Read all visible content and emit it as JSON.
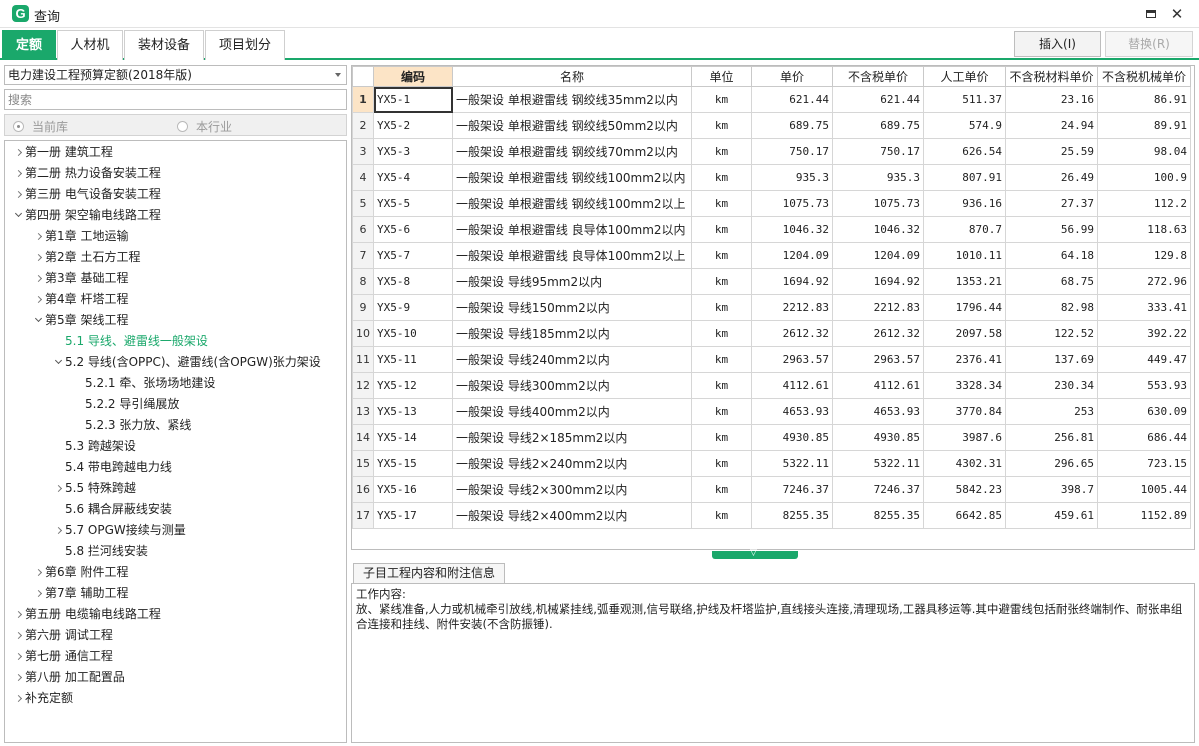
{
  "window": {
    "logo_letter": "G",
    "title": "查询",
    "maximize_icon": "maximize-icon",
    "close_icon": "close-icon",
    "close_glyph": "✕"
  },
  "tabs": [
    {
      "label": "定额",
      "active": true
    },
    {
      "label": "人材机",
      "active": false
    },
    {
      "label": "装材设备",
      "active": false
    },
    {
      "label": "项目划分",
      "active": false
    }
  ],
  "toolbar": {
    "insert_label": "插入(I)",
    "replace_label": "替换(R)"
  },
  "library": {
    "selected": "电力建设工程预算定额(2018年版)"
  },
  "search": {
    "placeholder": "搜索"
  },
  "scope": {
    "option1": "当前库",
    "option2": "本行业"
  },
  "tree": [
    {
      "label": "第一册 建筑工程",
      "level": 0,
      "expand": "collapsed"
    },
    {
      "label": "第二册 热力设备安装工程",
      "level": 0,
      "expand": "collapsed"
    },
    {
      "label": "第三册 电气设备安装工程",
      "level": 0,
      "expand": "collapsed"
    },
    {
      "label": "第四册 架空输电线路工程",
      "level": 0,
      "expand": "expanded"
    },
    {
      "label": "第1章 工地运输",
      "level": 1,
      "expand": "collapsed"
    },
    {
      "label": "第2章 土石方工程",
      "level": 1,
      "expand": "collapsed"
    },
    {
      "label": "第3章 基础工程",
      "level": 1,
      "expand": "collapsed"
    },
    {
      "label": "第4章 杆塔工程",
      "level": 1,
      "expand": "collapsed"
    },
    {
      "label": "第5章 架线工程",
      "level": 1,
      "expand": "expanded"
    },
    {
      "label": "5.1 导线、避雷线一般架设",
      "level": 2,
      "expand": "none",
      "selected": true
    },
    {
      "label": "5.2 导线(含OPPC)、避雷线(含OPGW)张力架设",
      "level": 2,
      "expand": "expanded"
    },
    {
      "label": "5.2.1 牵、张场场地建设",
      "level": 3,
      "expand": "none"
    },
    {
      "label": "5.2.2 导引绳展放",
      "level": 3,
      "expand": "none"
    },
    {
      "label": "5.2.3 张力放、紧线",
      "level": 3,
      "expand": "none"
    },
    {
      "label": "5.3 跨越架设",
      "level": 2,
      "expand": "none"
    },
    {
      "label": "5.4 带电跨越电力线",
      "level": 2,
      "expand": "none"
    },
    {
      "label": "5.5 特殊跨越",
      "level": 2,
      "expand": "collapsed"
    },
    {
      "label": "5.6 耦合屏蔽线安装",
      "level": 2,
      "expand": "none"
    },
    {
      "label": "5.7 OPGW接续与测量",
      "level": 2,
      "expand": "collapsed"
    },
    {
      "label": "5.8 拦河线安装",
      "level": 2,
      "expand": "none"
    },
    {
      "label": "第6章 附件工程",
      "level": 1,
      "expand": "collapsed"
    },
    {
      "label": "第7章 辅助工程",
      "level": 1,
      "expand": "collapsed"
    },
    {
      "label": "第五册 电缆输电线路工程",
      "level": 0,
      "expand": "collapsed"
    },
    {
      "label": "第六册 调试工程",
      "level": 0,
      "expand": "collapsed"
    },
    {
      "label": "第七册 通信工程",
      "level": 0,
      "expand": "collapsed"
    },
    {
      "label": "第八册 加工配置品",
      "level": 0,
      "expand": "collapsed"
    },
    {
      "label": "补充定额",
      "level": 0,
      "expand": "collapsed"
    }
  ],
  "grid": {
    "headers": [
      "编码",
      "名称",
      "单位",
      "单价",
      "不含税单价",
      "人工单价",
      "不含税材料单价",
      "不含税机械单价"
    ],
    "rows": [
      [
        "1",
        "YX5-1",
        "一般架设 单根避雷线 钢绞线35mm2以内",
        "km",
        "621.44",
        "621.44",
        "511.37",
        "23.16",
        "86.91"
      ],
      [
        "2",
        "YX5-2",
        "一般架设 单根避雷线 钢绞线50mm2以内",
        "km",
        "689.75",
        "689.75",
        "574.9",
        "24.94",
        "89.91"
      ],
      [
        "3",
        "YX5-3",
        "一般架设 单根避雷线 钢绞线70mm2以内",
        "km",
        "750.17",
        "750.17",
        "626.54",
        "25.59",
        "98.04"
      ],
      [
        "4",
        "YX5-4",
        "一般架设 单根避雷线 钢绞线100mm2以内",
        "km",
        "935.3",
        "935.3",
        "807.91",
        "26.49",
        "100.9"
      ],
      [
        "5",
        "YX5-5",
        "一般架设 单根避雷线 钢绞线100mm2以上",
        "km",
        "1075.73",
        "1075.73",
        "936.16",
        "27.37",
        "112.2"
      ],
      [
        "6",
        "YX5-6",
        "一般架设 单根避雷线 良导体100mm2以内",
        "km",
        "1046.32",
        "1046.32",
        "870.7",
        "56.99",
        "118.63"
      ],
      [
        "7",
        "YX5-7",
        "一般架设 单根避雷线 良导体100mm2以上",
        "km",
        "1204.09",
        "1204.09",
        "1010.11",
        "64.18",
        "129.8"
      ],
      [
        "8",
        "YX5-8",
        "一般架设 导线95mm2以内",
        "km",
        "1694.92",
        "1694.92",
        "1353.21",
        "68.75",
        "272.96"
      ],
      [
        "9",
        "YX5-9",
        "一般架设 导线150mm2以内",
        "km",
        "2212.83",
        "2212.83",
        "1796.44",
        "82.98",
        "333.41"
      ],
      [
        "10",
        "YX5-10",
        "一般架设 导线185mm2以内",
        "km",
        "2612.32",
        "2612.32",
        "2097.58",
        "122.52",
        "392.22"
      ],
      [
        "11",
        "YX5-11",
        "一般架设 导线240mm2以内",
        "km",
        "2963.57",
        "2963.57",
        "2376.41",
        "137.69",
        "449.47"
      ],
      [
        "12",
        "YX5-12",
        "一般架设 导线300mm2以内",
        "km",
        "4112.61",
        "4112.61",
        "3328.34",
        "230.34",
        "553.93"
      ],
      [
        "13",
        "YX5-13",
        "一般架设 导线400mm2以内",
        "km",
        "4653.93",
        "4653.93",
        "3770.84",
        "253",
        "630.09"
      ],
      [
        "14",
        "YX5-14",
        "一般架设 导线2×185mm2以内",
        "km",
        "4930.85",
        "4930.85",
        "3987.6",
        "256.81",
        "686.44"
      ],
      [
        "15",
        "YX5-15",
        "一般架设 导线2×240mm2以内",
        "km",
        "5322.11",
        "5322.11",
        "4302.31",
        "296.65",
        "723.15"
      ],
      [
        "16",
        "YX5-16",
        "一般架设 导线2×300mm2以内",
        "km",
        "7246.37",
        "7246.37",
        "5842.23",
        "398.7",
        "1005.44"
      ],
      [
        "17",
        "YX5-17",
        "一般架设 导线2×400mm2以内",
        "km",
        "8255.35",
        "8255.35",
        "6642.85",
        "459.61",
        "1152.89"
      ]
    ]
  },
  "info": {
    "tab_label": "子目工程内容和附注信息",
    "heading": "工作内容:",
    "body": "放、紧线准备,人力或机械牵引放线,机械紧挂线,弧垂观测,信号联络,护线及杆塔监护,直线接头连接,清理现场,工器具移运等.其中避雷线包括耐张终端制作、耐张串组合连接和挂线、附件安装(不含防振锤)."
  },
  "colors": {
    "accent": "#1aa86b",
    "header_highlight": "#fce4c6"
  }
}
